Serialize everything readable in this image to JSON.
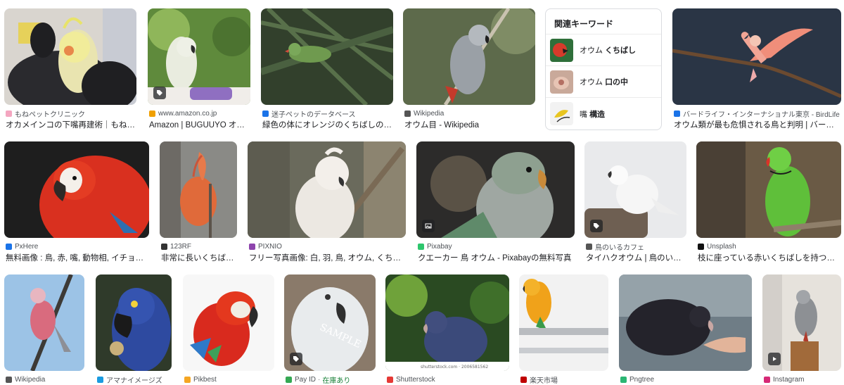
{
  "related": {
    "heading": "関連キーワード",
    "items": [
      {
        "prefix": "オウム ",
        "bold": "くちばし"
      },
      {
        "prefix": "オウム ",
        "bold": "口の中"
      },
      {
        "prefix": "嘴 ",
        "bold": "構造"
      }
    ]
  },
  "rows": [
    [
      {
        "source": "もねペットクリニック",
        "title": "オカメインコの下嘴再建術｜もね…",
        "fav_color": "#f4a6c0"
      },
      {
        "source": "www.amazon.co.jp",
        "title": "Amazon | BUGUUYO オウ…",
        "fav_color": "#f0a000"
      },
      {
        "source": "迷子ペットのデータベース",
        "title": "緑色の体にオレンジのくちばしの…",
        "fav_color": "#1a73e8"
      },
      {
        "source": "Wikipedia",
        "title": "オウム目 - Wikipedia",
        "fav_color": "#555555"
      },
      {
        "source": "バードライフ・インターナショナル東京 - BirdLife I…",
        "title": "オウム類が最も危惧される鳥と判明 | バード…",
        "fav_color": "#1a73e8"
      }
    ],
    [
      {
        "source": "PxHere",
        "title": "無料画像 : 鳥, 赤, 嘴, 動物相, イチョ…",
        "fav_color": "#1a73e8"
      },
      {
        "source": "123RF",
        "title": "非常に長いくちば…",
        "fav_color": "#333333"
      },
      {
        "source": "PIXNIO",
        "title": "フリー写真画像: 白, 羽, 鳥, オウム, くち…",
        "fav_color": "#8e44ad"
      },
      {
        "source": "Pixabay",
        "title": "クエーカー 鳥 オウム - Pixabayの無料写真",
        "fav_color": "#2ec66d"
      },
      {
        "source": "鳥のいるカフェ",
        "title": "タイハクオウム | 鳥のい…",
        "fav_color": "#555555"
      },
      {
        "source": "Unsplash",
        "title": "枝に座っている赤いくちばしを持つ緑…",
        "fav_color": "#111111"
      }
    ],
    [
      {
        "source": "Wikipedia",
        "fav_color": "#555555"
      },
      {
        "source": "アマナイメージズ",
        "fav_color": "#1a9be0"
      },
      {
        "source": "Pikbest",
        "fav_color": "#f5a623"
      },
      {
        "source": "Pay ID",
        "stock": "在庫あり",
        "fav_color": "#34a853"
      },
      {
        "source": "Shutterstock",
        "fav_color": "#e53935"
      },
      {
        "source": "楽天市場",
        "fav_color": "#bf0000"
      },
      {
        "source": "Pngtree",
        "fav_color": "#2bb673"
      },
      {
        "source": "Instagram",
        "fav_color": "#d62976"
      }
    ]
  ],
  "badges": {
    "tag_icon": "tag-icon",
    "image_icon": "image-icon",
    "play_icon": "play-icon"
  },
  "watermarks": {
    "sample": "SAMPLE",
    "shutterstock": "shutterstock.com · 2006581562"
  }
}
